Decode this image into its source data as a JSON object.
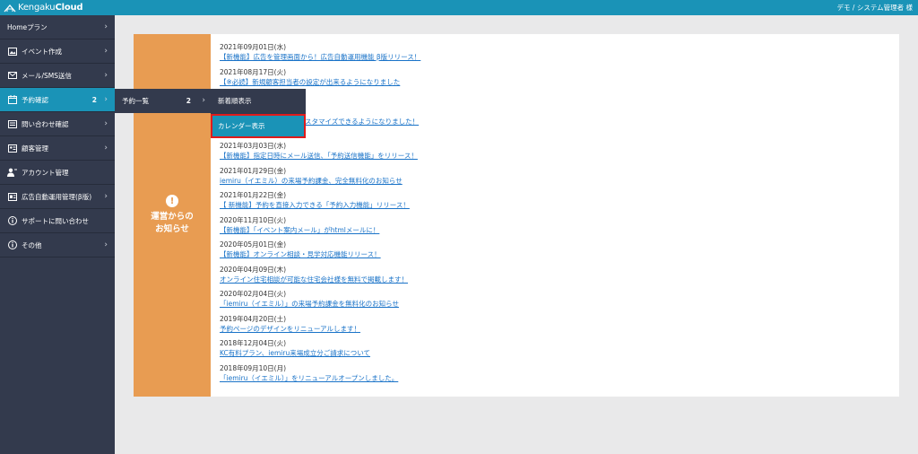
{
  "header": {
    "logo_prefix": "Kengaku",
    "logo_suffix": "Cloud",
    "user_label": "デモ / システム管理者 様"
  },
  "sidebar": {
    "items": [
      {
        "label": "Homeプラン",
        "icon": "none",
        "chevron": true
      },
      {
        "label": "イベント作成",
        "icon": "image-icon",
        "chevron": true
      },
      {
        "label": "メール/SMS送信",
        "icon": "mail-icon",
        "chevron": true
      },
      {
        "label": "予約確認",
        "icon": "calendar-icon",
        "chevron": true,
        "badge": "2",
        "active": true
      },
      {
        "label": "問い合わせ確認",
        "icon": "inbox-icon",
        "chevron": true
      },
      {
        "label": "顧客管理",
        "icon": "id-card-icon",
        "chevron": true
      },
      {
        "label": "アカウント管理",
        "icon": "user-icon",
        "chevron": false
      },
      {
        "label": "広告自動運用管理(β版)",
        "icon": "ad-icon",
        "chevron": true
      },
      {
        "label": "サポートに問い合わせ",
        "icon": "info-icon",
        "chevron": false
      },
      {
        "label": "その他",
        "icon": "info-icon",
        "chevron": true
      }
    ]
  },
  "submenu": {
    "item_label": "予約一覧",
    "item_badge": "2",
    "options": [
      "新着順表示",
      "カレンダー表示"
    ]
  },
  "notice": {
    "title_line1": "運営からの",
    "title_line2": "お知らせ",
    "items": [
      {
        "date": "2021年09月01日(水)",
        "text": "【新機能】広告を管理画面から！広告自動運用機能 β版リリース！"
      },
      {
        "date": "2021年08月17日(火)",
        "text": "【※必読】新規顧客担当者の設定が出来るようになりました"
      },
      {
        "date": "",
        "text": ""
      },
      {
        "date": "",
        "text": "スタマイズできるようになりました！"
      },
      {
        "date": "2021年03月03日(水)",
        "text": "【新機能】指定日時にメール送信、「予約送信機能」をリリース！"
      },
      {
        "date": "2021年01月29日(金)",
        "text": "iemiru（イエミル）の来場予約課金、完全無料化のお知らせ"
      },
      {
        "date": "2021年01月22日(金)",
        "text": "【 新機能】予約を直接入力できる「予約入力機能」リリース！"
      },
      {
        "date": "2020年11月10日(火)",
        "text": "【新機能】「イベント案内メール」がhtmlメールに！"
      },
      {
        "date": "2020年05月01日(金)",
        "text": "【新機能】オンライン相談・見学対応機能リリース！"
      },
      {
        "date": "2020年04月09日(木)",
        "text": "オンライン住宅相談が可能な住宅会社様を無料で掲載します！"
      },
      {
        "date": "2020年02月04日(火)",
        "text": "「iemiru（イエミル）」の来場予約課金を無料化のお知らせ"
      },
      {
        "date": "2019年04月20日(土)",
        "text": "予約ページのデザインをリニューアルします！"
      },
      {
        "date": "2018年12月04日(火)",
        "text": "KC有料プラン、iemiru来場成立分ご請求について"
      },
      {
        "date": "2018年09月10日(月)",
        "text": "「iemiru（イエミル）」をリニューアルオープンしました。"
      }
    ]
  }
}
